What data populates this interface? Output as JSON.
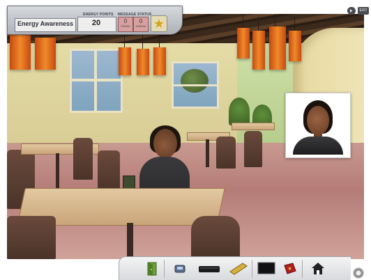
{
  "hud": {
    "title": "Energy Awareness",
    "points_label": "ENERGY POINTS",
    "points_value": "20",
    "status_label": "MESSAGE STATUS",
    "status_left_value": "0",
    "status_left_sub": "PEDING",
    "status_right_value": "0",
    "status_right_sub": "UNREAD"
  },
  "top_buttons": {
    "exit_label": "EXIT"
  },
  "icons": {
    "star": "star-icon",
    "audio": "audio-icon",
    "door": "door-exit-icon",
    "phone": "phone-icon",
    "keyboard": "keyboard-icon",
    "notebook": "notebook-icon",
    "monitor": "monitor-icon",
    "book": "book-icon",
    "home": "home-icon",
    "settings": "gear-icon"
  },
  "colors": {
    "hud_bg": "#c4c7cc",
    "status_bg": "#d8a0a0",
    "star_gold": "#d4a51e",
    "lamp_orange": "#e0701e"
  }
}
